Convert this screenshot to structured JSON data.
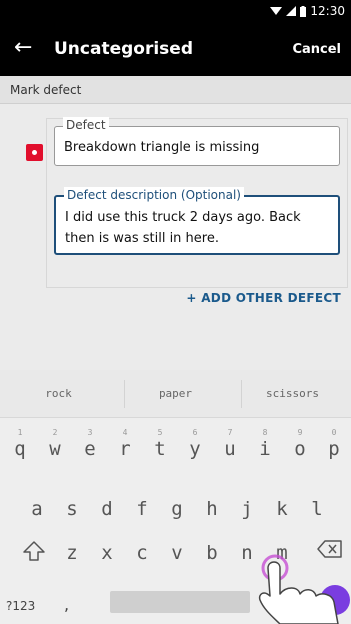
{
  "status_bar": {
    "time": "12:30",
    "wifi_icon": "wifi-icon",
    "signal_icon": "signal-icon",
    "battery_icon": "battery-icon"
  },
  "app_bar": {
    "back_icon": "arrow-left-icon",
    "title": "Uncategorised",
    "cancel_label": "Cancel"
  },
  "section_header": "Mark defect",
  "defect_form": {
    "defect_label": "Defect",
    "defect_value": "Breakdown triangle is missing",
    "description_label": "Defect description (Optional)",
    "description_value": "I did use this truck 2 days ago. Back then is was still in here.",
    "add_defect_label": "+ ADD OTHER DEFECT"
  },
  "keyboard": {
    "suggestions": [
      "rock",
      "paper",
      "scissors"
    ],
    "row1": [
      {
        "ch": "q",
        "alt": "1"
      },
      {
        "ch": "w",
        "alt": "2"
      },
      {
        "ch": "e",
        "alt": "3"
      },
      {
        "ch": "r",
        "alt": "4"
      },
      {
        "ch": "t",
        "alt": "5"
      },
      {
        "ch": "y",
        "alt": "6"
      },
      {
        "ch": "u",
        "alt": "7"
      },
      {
        "ch": "i",
        "alt": "8"
      },
      {
        "ch": "o",
        "alt": "9"
      },
      {
        "ch": "p",
        "alt": "0"
      }
    ],
    "row2": [
      "a",
      "s",
      "d",
      "f",
      "g",
      "h",
      "j",
      "k",
      "l"
    ],
    "row3": [
      "z",
      "x",
      "c",
      "v",
      "b",
      "n",
      "m"
    ],
    "symbols_label": "?123",
    "comma_label": ",",
    "shift_icon": "shift-arrow-icon",
    "backspace_icon": "backspace-icon",
    "enter_icon": "enter-icon"
  },
  "overlay": {
    "hand_icon": "pointing-hand-icon"
  },
  "colors": {
    "accent": "#1e4f7a",
    "defect_red": "#e10e2c",
    "link_blue": "#1b5a8c",
    "enter_purple": "#7a3de0"
  }
}
